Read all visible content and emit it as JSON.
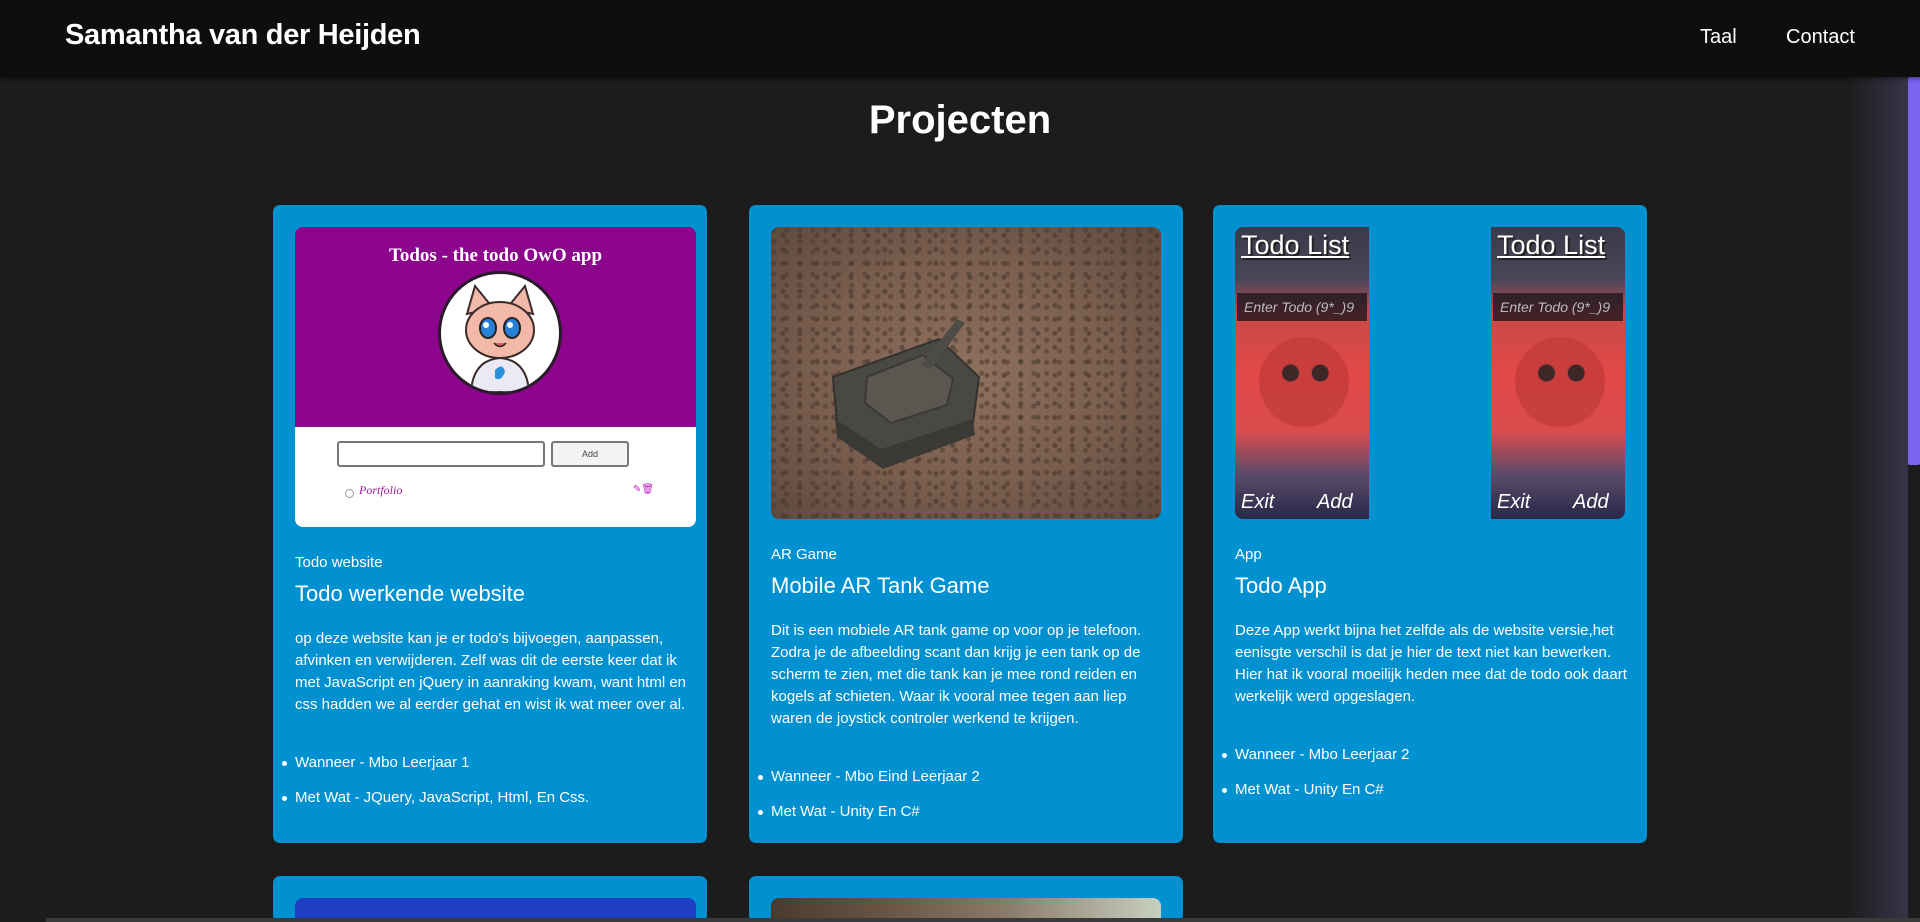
{
  "navbar": {
    "brand": "Samantha van der Heijden",
    "links": [
      "Taal",
      "Contact"
    ]
  },
  "page": {
    "title": "Projecten"
  },
  "projects": [
    {
      "category": "Todo website",
      "title": "Todo werkende website",
      "description": "op deze website kan je er todo's bijvoegen, aanpassen, afvinken en verwijderen. Zelf was dit de eerste keer dat ik met JavaScript en jQuery in aanraking kwam, want html en css hadden we al eerder gehat en wist ik wat meer over al.",
      "details": [
        "Wanneer - Mbo Leerjaar 1",
        "Met Wat - JQuery, JavaScript, Html, En Css."
      ],
      "image": {
        "title": "Todos - the todo OwO app",
        "add_label": "Add",
        "item_label": "Portfolio"
      }
    },
    {
      "category": "AR Game",
      "title": "Mobile AR Tank Game",
      "description": "Dit is een mobiele AR tank game op voor op je telefoon. Zodra je de afbeelding scant dan krijg je een tank op de scherm te zien, met die tank kan je mee rond reiden en kogels af schieten. Waar ik vooral mee tegen aan liep waren de joystick controler werkend te krijgen.",
      "details": [
        "Wanneer - Mbo Eind Leerjaar 2",
        "Met Wat - Unity En C#"
      ]
    },
    {
      "category": "App",
      "title": "Todo App",
      "description": "Deze App werkt bijna het zelfde als de website versie,het eenisgte verschil is dat je hier de text niet kan bewerken. Hier hat ik vooral moeilijk heden mee dat de todo ook daart werkelijk werd opgeslagen.",
      "details": [
        "Wanneer - Mbo Leerjaar 2",
        "Met Wat - Unity En C#"
      ],
      "image": {
        "screen_title": "Todo List",
        "input_placeholder": "Enter Todo (9*_)9",
        "exit_label": "Exit",
        "add_label": "Add"
      }
    }
  ],
  "colors": {
    "card": "#0291d0",
    "navbar": "#0e0e0e",
    "background": "#1c1c1c",
    "scrollbar": "#7a64f0"
  }
}
